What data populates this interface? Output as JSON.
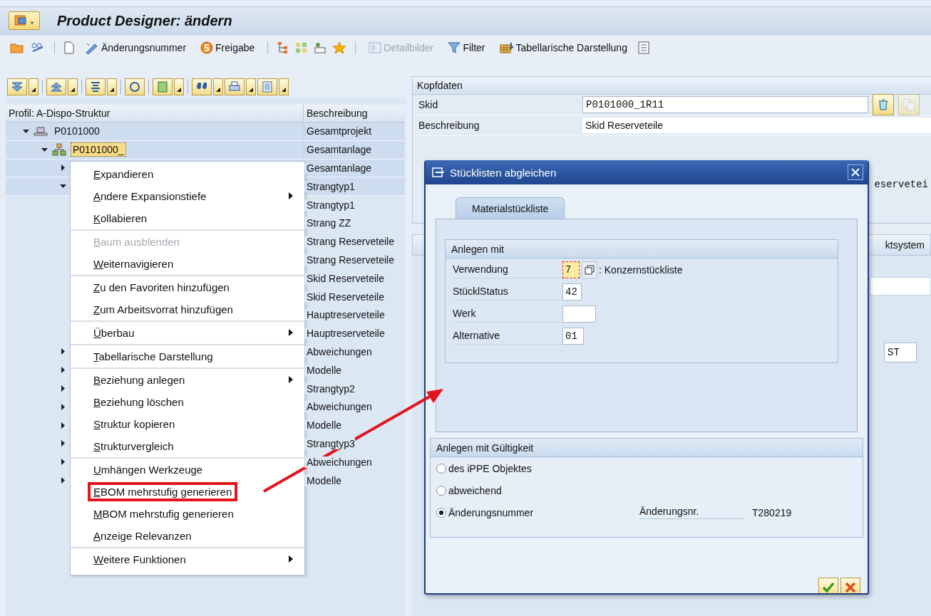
{
  "window": {
    "title": "Product Designer: ändern"
  },
  "toolbar": {
    "buttons": [
      {
        "label": "Änderungsnummer",
        "disabled": false
      },
      {
        "label": "Freigabe",
        "disabled": false
      },
      {
        "label": "Detailbilder",
        "disabled": true
      },
      {
        "label": "Filter",
        "disabled": false
      },
      {
        "label": "Tabellarische Darstellung",
        "disabled": false
      }
    ]
  },
  "tree": {
    "columns": [
      "Profil: A-Dispo-Struktur",
      "Beschreibung"
    ],
    "nodes": [
      {
        "label": "P0101000",
        "description": "Gesamtprojekt",
        "expanded": true,
        "selected": false,
        "children": [
          {
            "label": "P0101000_",
            "description": "Gesamtanlage",
            "expanded": true,
            "selected": true,
            "children": [
              {
                "description": "Gesamtanlage",
                "expanded": false
              },
              {
                "description": "Strangtyp1",
                "expanded": true,
                "children": [
                  {
                    "description": "Strangtyp1"
                  },
                  {
                    "description": "Strang ZZ"
                  },
                  {
                    "description": "Strang Reserveteile"
                  },
                  {
                    "description": "Strang Reserveteile"
                  },
                  {
                    "description": "Skid Reserveteile"
                  },
                  {
                    "description": "Skid Reserveteile"
                  },
                  {
                    "description": "Hauptreserveteile"
                  },
                  {
                    "description": "Hauptreserveteile"
                  }
                ]
              },
              {
                "description": "Abweichungen",
                "expanded": false
              },
              {
                "description": "Modelle",
                "expanded": false
              },
              {
                "description": "Strangtyp2",
                "expanded": false
              },
              {
                "description": "Abweichungen",
                "expanded": false
              },
              {
                "description": "Modelle",
                "expanded": false
              },
              {
                "description": "Strangtyp3",
                "expanded": false
              },
              {
                "description": "Abweichungen",
                "expanded": false
              },
              {
                "description": "Modelle",
                "expanded": false
              }
            ]
          }
        ]
      }
    ]
  },
  "context_menu": {
    "groups": [
      [
        {
          "label": "Expandieren",
          "submenu": false,
          "disabled": false,
          "highlighted": false
        },
        {
          "label": "Andere Expansionstiefe",
          "submenu": true,
          "disabled": false,
          "highlighted": false
        },
        {
          "label": "Kollabieren",
          "submenu": false,
          "disabled": false,
          "highlighted": false
        }
      ],
      [
        {
          "label": "Baum ausblenden",
          "submenu": false,
          "disabled": true,
          "highlighted": false
        },
        {
          "label": "Weiternavigieren",
          "submenu": false,
          "disabled": false,
          "highlighted": false
        }
      ],
      [
        {
          "label": "Zu den Favoriten hinzufügen",
          "submenu": false,
          "disabled": false,
          "highlighted": false
        },
        {
          "label": "Zum Arbeitsvorrat hinzufügen",
          "submenu": false,
          "disabled": false,
          "highlighted": false
        }
      ],
      [
        {
          "label": "Überbau",
          "submenu": true,
          "disabled": false,
          "highlighted": false
        }
      ],
      [
        {
          "label": "Tabellarische Darstellung",
          "submenu": false,
          "disabled": false,
          "highlighted": false
        }
      ],
      [
        {
          "label": "Beziehung anlegen",
          "submenu": true,
          "disabled": false,
          "highlighted": false
        },
        {
          "label": "Beziehung löschen",
          "submenu": false,
          "disabled": false,
          "highlighted": false
        },
        {
          "label": "Struktur kopieren",
          "submenu": false,
          "disabled": false,
          "highlighted": false
        },
        {
          "label": "Strukturvergleich",
          "submenu": false,
          "disabled": false,
          "highlighted": false
        }
      ],
      [
        {
          "label": "Umhängen Werkzeuge",
          "submenu": false,
          "disabled": false,
          "highlighted": false
        },
        {
          "label": "EBOM mehrstufig generieren",
          "submenu": false,
          "disabled": false,
          "highlighted": true
        },
        {
          "label": "MBOM mehrstufig generieren",
          "submenu": false,
          "disabled": false,
          "highlighted": false
        },
        {
          "label": "Anzeige Relevanzen",
          "submenu": false,
          "disabled": false,
          "highlighted": false
        }
      ],
      [
        {
          "label": "Weitere Funktionen",
          "submenu": true,
          "disabled": false,
          "highlighted": false
        }
      ]
    ]
  },
  "header_data": {
    "title": "Kopfdaten",
    "fields": [
      {
        "label": "Skid",
        "value": "P0101000_1R11"
      },
      {
        "label": "Beschreibung",
        "value": "Skid Reserveteile"
      }
    ]
  },
  "background_fragments": {
    "text": "eservetei",
    "section_title": "ktsystem",
    "field_value": "ST"
  },
  "dialog": {
    "title": "Stücklisten abgleichen",
    "tabs": [
      {
        "label": "Materialstückliste",
        "selected": true
      }
    ],
    "group_1": {
      "title": "Anlegen mit",
      "fields": [
        {
          "label": "Verwendung",
          "value": "7",
          "focused": true,
          "note": ": Konzernstückliste"
        },
        {
          "label": "StücklStatus",
          "value": "42",
          "focused": false
        },
        {
          "label": "Werk",
          "focused": false
        },
        {
          "label": "Alternative",
          "value": "01",
          "focused": false
        }
      ]
    },
    "group_2": {
      "title": "Anlegen mit Gültigkeit",
      "options": [
        {
          "label": "des iPPE Objektes",
          "selected": false
        },
        {
          "label": "abweichend",
          "selected": false
        },
        {
          "label": "Änderungsnummer",
          "selected": true,
          "field_label": "Änderungsnr.",
          "field_value": "T280219"
        }
      ]
    }
  }
}
